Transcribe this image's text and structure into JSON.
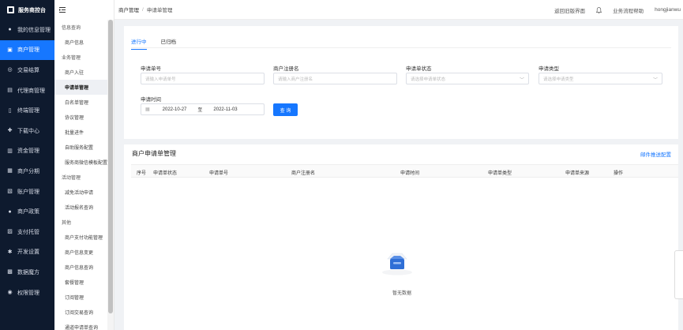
{
  "sidebar": {
    "brand": "服务商控台",
    "items": [
      {
        "label": "我的信息管理",
        "icon": "user-icon",
        "glyph": "●"
      },
      {
        "label": "商户管理",
        "icon": "merchant-icon",
        "glyph": "▣",
        "active": true
      },
      {
        "label": "交易结算",
        "icon": "settlement-icon",
        "glyph": "◎"
      },
      {
        "label": "代理商管理",
        "icon": "agent-icon",
        "glyph": "▤"
      },
      {
        "label": "终端管理",
        "icon": "terminal-icon",
        "glyph": "▯"
      },
      {
        "label": "下载中心",
        "icon": "download-icon",
        "glyph": "✚"
      },
      {
        "label": "资金管理",
        "icon": "funds-icon",
        "glyph": "▥"
      },
      {
        "label": "商户分期",
        "icon": "installment-icon",
        "glyph": "▦"
      },
      {
        "label": "账户管理",
        "icon": "account-icon",
        "glyph": "▧"
      },
      {
        "label": "商户政策",
        "icon": "policy-icon",
        "glyph": "●"
      },
      {
        "label": "支付托管",
        "icon": "custody-icon",
        "glyph": "▨"
      },
      {
        "label": "开发设置",
        "icon": "dev-settings-icon",
        "glyph": "✱"
      },
      {
        "label": "数据魔方",
        "icon": "data-cube-icon",
        "glyph": "▩"
      },
      {
        "label": "权限管理",
        "icon": "permission-icon",
        "glyph": "◉"
      }
    ]
  },
  "submenu": [
    {
      "type": "group",
      "label": "信息查询"
    },
    {
      "type": "item",
      "label": "商户信息"
    },
    {
      "type": "group",
      "label": "业务管理"
    },
    {
      "type": "item",
      "label": "商户入驻"
    },
    {
      "type": "item",
      "label": "申请单管理",
      "active": true
    },
    {
      "type": "item",
      "label": "白名单管理"
    },
    {
      "type": "item",
      "label": "协议管理"
    },
    {
      "type": "item",
      "label": "批量进件"
    },
    {
      "type": "item",
      "label": "自助服务配置"
    },
    {
      "type": "item",
      "label": "服务商微信模板配置"
    },
    {
      "type": "group",
      "label": "活动管理"
    },
    {
      "type": "item",
      "label": "减免活动申请"
    },
    {
      "type": "item",
      "label": "活动报名查询"
    },
    {
      "type": "group",
      "label": "其他"
    },
    {
      "type": "item",
      "label": "商户支付功能管理"
    },
    {
      "type": "item",
      "label": "商户信息变更"
    },
    {
      "type": "item",
      "label": "商户信息查询"
    },
    {
      "type": "item",
      "label": "套餐管理"
    },
    {
      "type": "item",
      "label": "订阅管理"
    },
    {
      "type": "item",
      "label": "订阅交易查询"
    },
    {
      "type": "item",
      "label": "通道申请单查询"
    }
  ],
  "topbar": {
    "breadcrumb": [
      "商户管理",
      "申请单管理"
    ],
    "back_link": "返回旧版界面",
    "help": "业务流程帮助",
    "username": "hongjianwu"
  },
  "filters": {
    "tabs": [
      "进行中",
      "已归档"
    ],
    "active_tab": 0,
    "fields": [
      {
        "label": "申请单号",
        "placeholder": "请输入申请单号",
        "type": "input"
      },
      {
        "label": "商户注册名",
        "placeholder": "请输入商户注册名",
        "type": "input"
      },
      {
        "label": "申请单状态",
        "placeholder": "请选择申请单状态",
        "type": "select"
      },
      {
        "label": "申请类型",
        "placeholder": "请选择申请类型",
        "type": "select"
      }
    ],
    "time_label": "申请时间",
    "date_start": "2022-10-27",
    "date_sep": "至",
    "date_end": "2022-11-03",
    "query_button": "查 询"
  },
  "table": {
    "title": "商户申请单管理",
    "mail_link": "邮件推送配置",
    "columns": [
      "序号",
      "申请单状态",
      "申请单号",
      "商户注册名",
      "申请时间",
      "申请单类型",
      "申请单来源",
      "操作"
    ],
    "empty_text": "暂无数据"
  },
  "colors": {
    "primary": "#1677ff",
    "sidebar_bg": "#0e1a2e"
  }
}
